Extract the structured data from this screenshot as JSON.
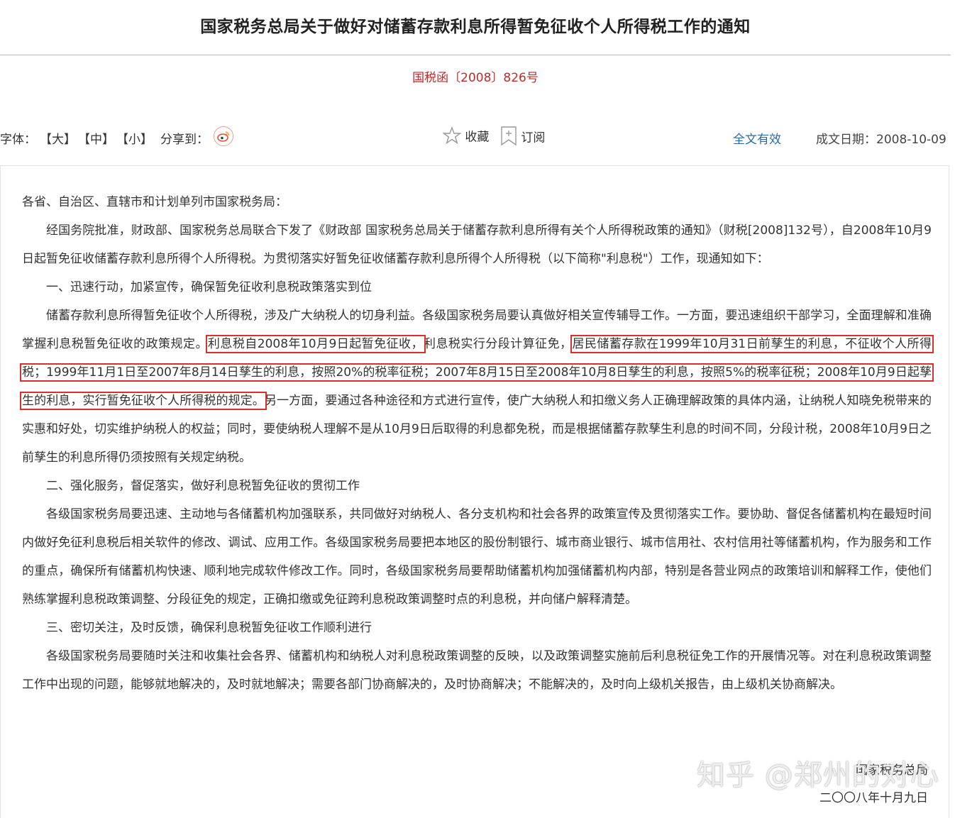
{
  "header": {
    "title": "国家税务总局关于做好对储蓄存款利息所得暂免征收个人所得税工作的通知",
    "doc_number": "国税函〔2008〕826号"
  },
  "toolbar": {
    "font_label": "字体：",
    "font_large": "【大】",
    "font_medium": "【中】",
    "font_small": "【小】",
    "share_label": "分享到：",
    "share_icon": "weibo-icon",
    "favorite_label": "收藏",
    "favorite_icon": "star-icon",
    "subscribe_label": "订阅",
    "subscribe_icon": "bookmark-plus-icon",
    "validity": "全文有效",
    "date": "成文日期：2008-10-09"
  },
  "body": {
    "salutation": "各省、自治区、直辖市和计划单列市国家税务局：",
    "intro": "经国务院批准，财政部、国家税务总局联合下发了《财政部 国家税务总局关于储蓄存款利息所得有关个人所得税政策的通知》（财税[2008]132号），自2008年10月9日起暂免征收储蓄存款利息所得个人所得税。为贯彻落实好暂免征收储蓄存款利息所得个人所得税（以下简称\"利息税\"）工作，现通知如下：",
    "section1_heading": "一、迅速行动，加紧宣传，确保暂免征收利息税政策落实到位",
    "section1_p1_a": "储蓄存款利息所得暂免征收个人所得税，涉及广大纳税人的切身利益。各级国家税务局要认真做好相关宣传辅导工作。一方面，要迅速组织干部学习，全面理解和准确掌握利息税暂免征收的政策规定。",
    "section1_p1_hl1": "利息税自2008年10月9日起暂免征收，",
    "section1_p1_b": "利息税实行分段计算征免，",
    "section1_p1_hl2": "居民储蓄存款在1999年10月31日前孳生的利息，不征收个人所得税；1999年11月1日至2007年8月14日孳生的利息，按照20%的税率征税；2007年8月15日至2008年10月8日孳生的利息，按照5%的税率征税；2008年10月9日起孳生的利息，实行暂免征收个人所得税的规定。",
    "section1_p1_c": "另一方面，要通过各种途径和方式进行宣传，使广大纳税人和扣缴义务人正确理解政策的具体内涵，让纳税人知晓免税带来的实惠和好处，切实维护纳税人的权益；同时，要使纳税人理解不是从10月9日后取得的利息都免税，而是根据储蓄存款孳生利息的时间不同，分段计税，2008年10月9日之前孳生的利息所得仍须按照有关规定纳税。",
    "section2_heading": "二、强化服务，督促落实，做好利息税暂免征收的贯彻工作",
    "section2_p1": "各级国家税务局要迅速、主动地与各储蓄机构加强联系，共同做好对纳税人、各分支机构和社会各界的政策宣传及贯彻落实工作。要协助、督促各储蓄机构在最短时间内做好免征利息税后相关软件的修改、调试、应用工作。各级国家税务局要把本地区的股份制银行、城市商业银行、城市信用社、农村信用社等储蓄机构，作为服务和工作的重点，确保所有储蓄机构快速、顺利地完成软件修改工作。同时，各级国家税务局要帮助储蓄机构加强储蓄机构内部，特别是各营业网点的政策培训和解释工作，使他们熟练掌握利息税政策调整、分段征免的规定，正确扣缴或免征跨利息税政策调整时点的利息税，并向储户解释清楚。",
    "section3_heading": "三、密切关注，及时反馈，确保利息税暂免征收工作顺利进行",
    "section3_p1": "各级国家税务局要随时关注和收集社会各界、储蓄机构和纳税人对利息税政策调整的反映，以及政策调整实施前后利息税征免工作的开展情况等。对在利息税政策调整工作中出现的问题，能够就地解决的，及时就地解决；需要各部门协商解决的，及时协商解决；不能解决的，及时向上级机关报告，由上级机关协商解决。",
    "signature_org": "国家税务总局",
    "signature_date": "二〇〇八年十月九日"
  },
  "watermark": "知乎 @郑州的对心",
  "colors": {
    "doc_number": "#c0292b",
    "validity_link": "#2d6aa8",
    "highlight_box": "#d7302d"
  }
}
